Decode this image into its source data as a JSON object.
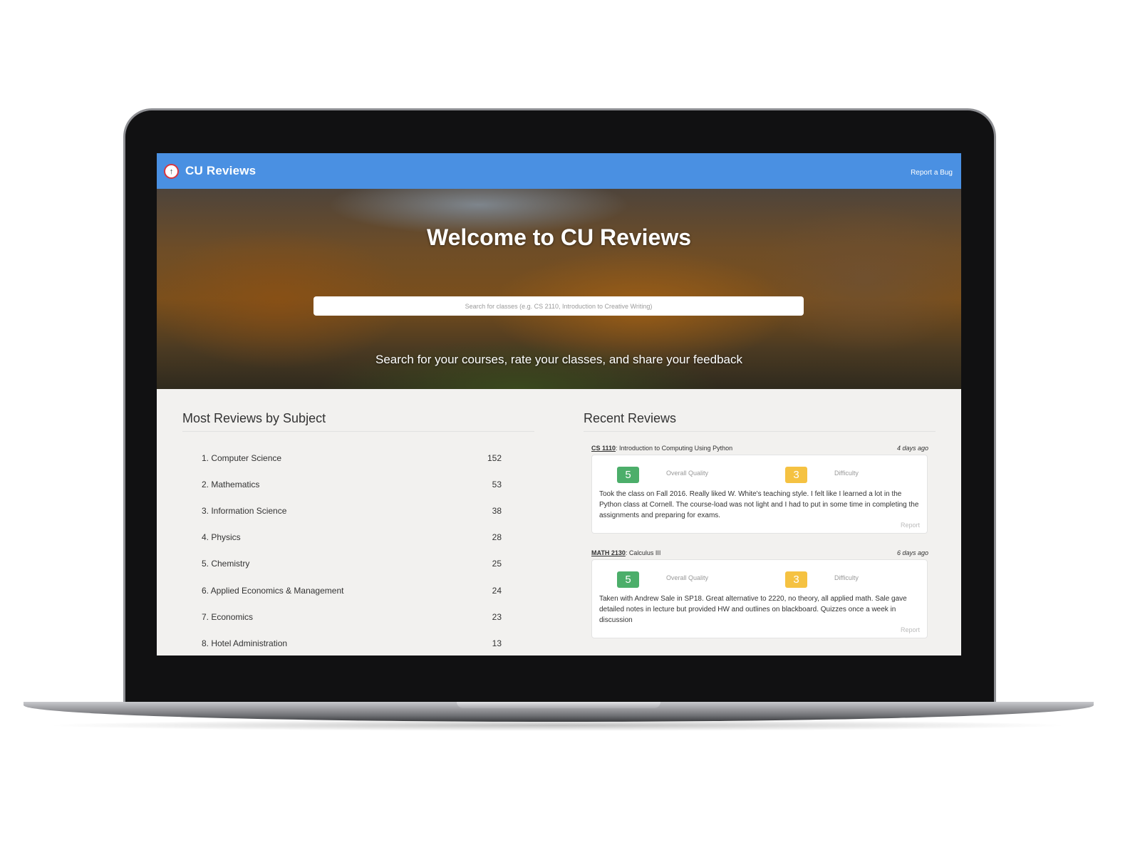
{
  "navbar": {
    "brand": "CU Reviews",
    "logo_icon": "up-arrow-circle-icon",
    "report_bug": "Report a Bug",
    "color": "#4a90e2"
  },
  "hero": {
    "title": "Welcome to CU Reviews",
    "search_placeholder": "Search for classes (e.g. CS 2110, Introduction to Creative Writing)",
    "subtitle": "Search for your courses, rate your classes, and share your feedback"
  },
  "subjects": {
    "title": "Most Reviews by Subject",
    "items": [
      {
        "name": "1. Computer Science",
        "count": "152"
      },
      {
        "name": "2. Mathematics",
        "count": "53"
      },
      {
        "name": "3. Information Science",
        "count": "38"
      },
      {
        "name": "4. Physics",
        "count": "28"
      },
      {
        "name": "5. Chemistry",
        "count": "25"
      },
      {
        "name": "6. Applied Economics & Management",
        "count": "24"
      },
      {
        "name": "7. Economics",
        "count": "23"
      },
      {
        "name": "8. Hotel Administration",
        "count": "13"
      }
    ]
  },
  "reviews": {
    "title": "Recent Reviews",
    "items": [
      {
        "code": "CS 1110",
        "course": ": Introduction to Computing Using Python",
        "date": "4 days ago",
        "quality": "5",
        "quality_label": "Overall Quality",
        "difficulty": "3",
        "difficulty_label": "Difficulty",
        "text": "Took the class on Fall 2016. Really liked W. White's teaching style. I felt like I learned a lot in the Python class at Cornell. The course-load was not light and I had to put in some time in completing the assignments and preparing for exams.",
        "report": "Report"
      },
      {
        "code": "MATH 2130",
        "course": ": Calculus III",
        "date": "6 days ago",
        "quality": "5",
        "quality_label": "Overall Quality",
        "difficulty": "3",
        "difficulty_label": "Difficulty",
        "text": "Taken with Andrew Sale in SP18. Great alternative to 2220, no theory, all applied math. Sale gave detailed notes in lecture but provided HW and outlines on blackboard. Quizzes once a week in discussion",
        "report": "Report"
      }
    ]
  },
  "colors": {
    "quality_badge": "#4cae6a",
    "difficulty_badge": "#f5c242"
  }
}
